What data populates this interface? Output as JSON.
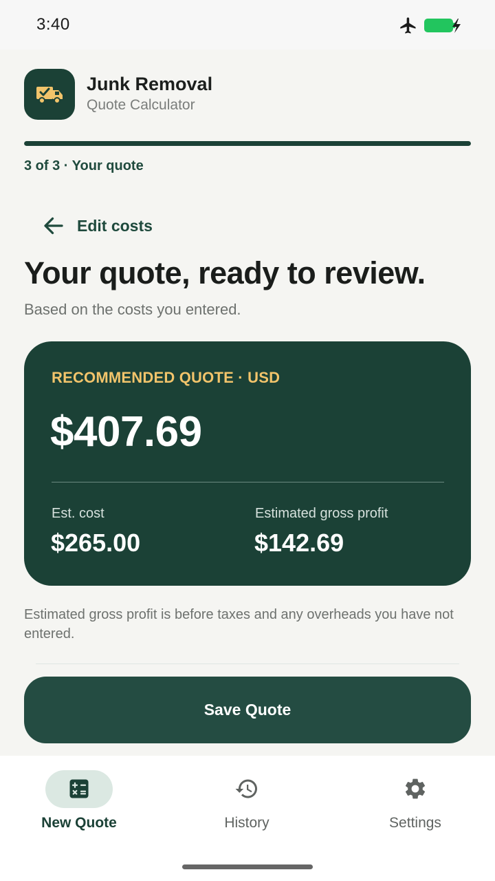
{
  "status_bar": {
    "time": "3:40"
  },
  "app": {
    "title": "Junk Removal",
    "subtitle": "Quote Calculator",
    "logo_icon": "junk-truck-icon"
  },
  "progress": {
    "fraction": 1.0,
    "step_label": "3 of 3 · Your quote"
  },
  "back": {
    "label": "Edit costs",
    "icon": "arrow-left-icon"
  },
  "page": {
    "title": "Your quote, ready to review.",
    "subtitle": "Based on the costs you entered."
  },
  "quote_card": {
    "label": "RECOMMENDED QUOTE · USD",
    "amount": "$407.69",
    "cost_label": "Est. cost",
    "cost_value": "$265.00",
    "profit_label": "Estimated gross profit",
    "profit_value": "$142.69"
  },
  "footnote": "Estimated gross profit is before taxes and any overheads you have not entered.",
  "save_button": {
    "label": "Save Quote"
  },
  "nav": {
    "items": [
      {
        "label": "New Quote",
        "icon": "calculator-icon",
        "active": true
      },
      {
        "label": "History",
        "icon": "history-icon",
        "active": false
      },
      {
        "label": "Settings",
        "icon": "gear-icon",
        "active": false
      }
    ]
  },
  "colors": {
    "primary": "#1b4136",
    "accent": "#f2c46b",
    "background": "#f5f5f2",
    "nav_active_pill": "#dbe8e2"
  }
}
